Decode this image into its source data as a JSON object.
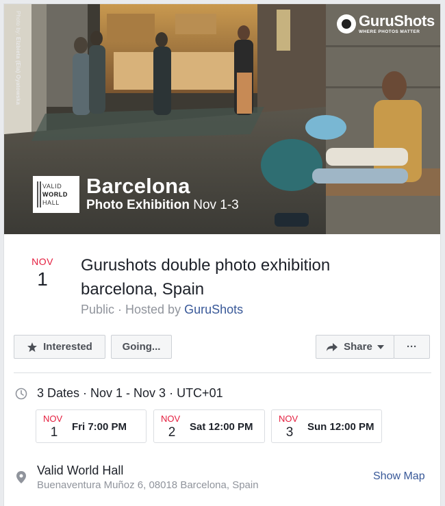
{
  "cover": {
    "photo_credit_prefix": "Photo by:",
    "photo_credit_name": "Elzbieta (Ela) Oyatowska",
    "brand_name": "GuruShots",
    "brand_tagline": "WHERE PHOTOS MATTER",
    "hall_logo_lines": [
      "VALID",
      "WORLD",
      "HALL"
    ],
    "city": "Barcelona",
    "subtitle_bold": "Photo Exhibition",
    "subtitle_dates": "Nov 1-3"
  },
  "event": {
    "month": "NOV",
    "day": "1",
    "title": "Gurushots double photo exhibition barcelona, Spain",
    "privacy": "Public",
    "hosted_by_prefix": " · Hosted by ",
    "host": "GuruShots"
  },
  "actions": {
    "interested": "Interested",
    "going": "Going...",
    "share": "Share",
    "more": "···"
  },
  "dates": {
    "summary": "3 Dates · Nov 1 - Nov 3 · UTC+01",
    "items": [
      {
        "month": "NOV",
        "day": "1",
        "time": "Fri 7:00 PM"
      },
      {
        "month": "NOV",
        "day": "2",
        "time": "Sat 12:00 PM"
      },
      {
        "month": "NOV",
        "day": "3",
        "time": "Sun 12:00 PM"
      }
    ]
  },
  "location": {
    "name": "Valid World Hall",
    "address": "Buenaventura Muñoz 6, 08018 Barcelona, Spain",
    "show_map": "Show Map"
  },
  "colors": {
    "accent_red": "#e41c3d",
    "link_blue": "#385898",
    "muted_gray": "#90949c"
  }
}
